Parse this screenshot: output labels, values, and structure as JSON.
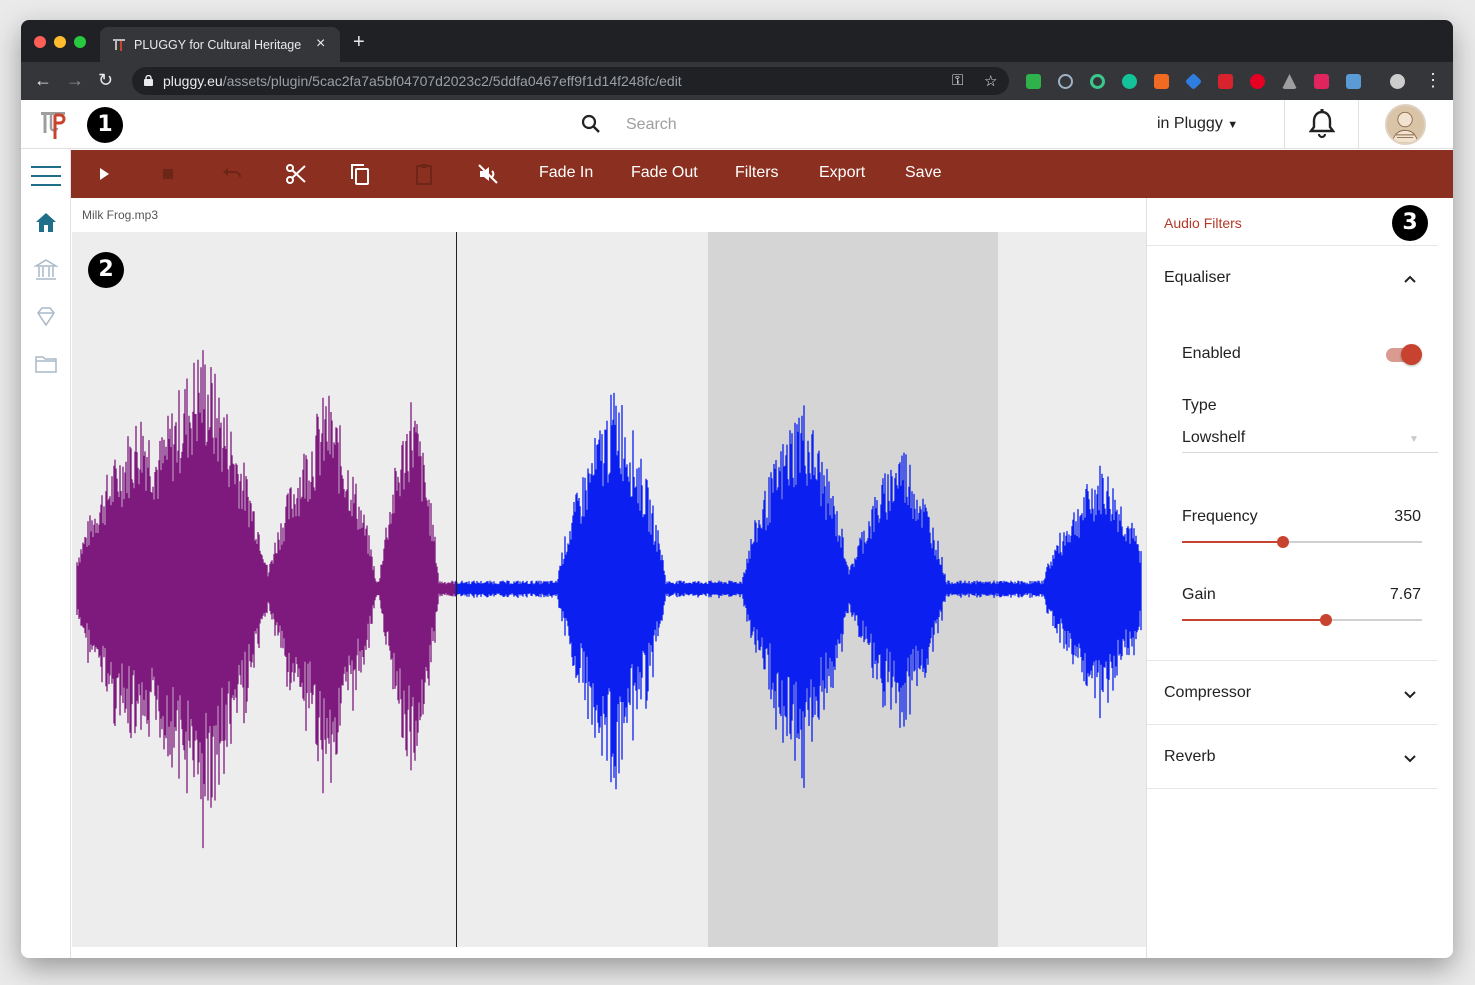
{
  "browser": {
    "tab_title": "PLUGGY for Cultural Heritage",
    "url_domain": "pluggy.eu",
    "url_path": "/assets/plugin/5cac2fa7a5bf04707d2023c2/5ddfa0467eff9f1d14f248fc/edit"
  },
  "header": {
    "search_placeholder": "Search",
    "scope_label": "in Pluggy",
    "marker_1": "1"
  },
  "toolbar": {
    "fade_in": "Fade In",
    "fade_out": "Fade Out",
    "filters": "Filters",
    "export": "Export",
    "save": "Save"
  },
  "editor": {
    "file_name": "Milk Frog.mp3",
    "marker_2": "2",
    "colors": {
      "played": "#7e1a7e",
      "unplayed": "#0a1ff0",
      "selection": "#d5d5d5"
    }
  },
  "filters_panel": {
    "title": "Audio Filters",
    "marker_3": "3",
    "equaliser": {
      "label": "Equaliser",
      "enabled_label": "Enabled",
      "enabled": true,
      "type_label": "Type",
      "type_value": "Lowshelf",
      "frequency_label": "Frequency",
      "frequency_value": "350",
      "frequency_fraction": 0.42,
      "gain_label": "Gain",
      "gain_value": "7.67",
      "gain_fraction": 0.6
    },
    "compressor": {
      "label": "Compressor"
    },
    "reverb": {
      "label": "Reverb"
    }
  },
  "accent_color": "#8b3020"
}
